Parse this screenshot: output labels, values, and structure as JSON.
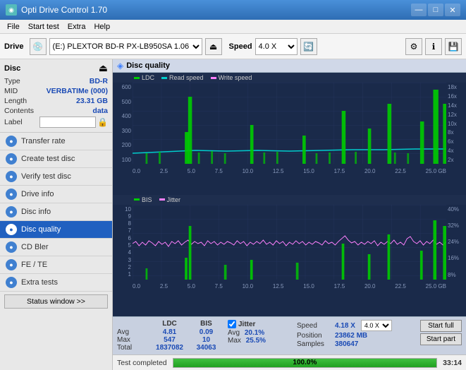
{
  "titlebar": {
    "icon": "◉",
    "title": "Opti Drive Control 1.70",
    "controls": {
      "minimize": "—",
      "maximize": "□",
      "close": "✕"
    }
  },
  "menubar": {
    "items": [
      "File",
      "Start test",
      "Extra",
      "Help"
    ]
  },
  "toolbar": {
    "drive_label": "Drive",
    "drive_value": "(E:) PLEXTOR BD-R  PX-LB950SA 1.06",
    "speed_label": "Speed",
    "speed_value": "4.0 X"
  },
  "disc": {
    "title": "Disc",
    "type_label": "Type",
    "type_value": "BD-R",
    "mid_label": "MID",
    "mid_value": "VERBATIMe (000)",
    "length_label": "Length",
    "length_value": "23.31 GB",
    "contents_label": "Contents",
    "contents_value": "data",
    "label_label": "Label"
  },
  "nav": {
    "items": [
      {
        "id": "transfer-rate",
        "label": "Transfer rate",
        "active": false
      },
      {
        "id": "create-test-disc",
        "label": "Create test disc",
        "active": false
      },
      {
        "id": "verify-test-disc",
        "label": "Verify test disc",
        "active": false
      },
      {
        "id": "drive-info",
        "label": "Drive info",
        "active": false
      },
      {
        "id": "disc-info",
        "label": "Disc info",
        "active": false
      },
      {
        "id": "disc-quality",
        "label": "Disc quality",
        "active": true
      },
      {
        "id": "cd-bler",
        "label": "CD Bler",
        "active": false
      },
      {
        "id": "fe-te",
        "label": "FE / TE",
        "active": false
      },
      {
        "id": "extra-tests",
        "label": "Extra tests",
        "active": false
      }
    ],
    "status_btn": "Status window >>"
  },
  "chart": {
    "title": "Disc quality",
    "legend_top": [
      {
        "id": "ldc",
        "label": "LDC",
        "color": "#00cc00"
      },
      {
        "id": "read-speed",
        "label": "Read speed",
        "color": "#00cccc"
      },
      {
        "id": "write-speed",
        "label": "Write speed",
        "color": "#ff80ff"
      }
    ],
    "legend_bottom": [
      {
        "id": "bis",
        "label": "BIS",
        "color": "#00cc00"
      },
      {
        "id": "jitter",
        "label": "Jitter",
        "color": "#ff80ff"
      }
    ],
    "x_labels": [
      "0.0",
      "2.5",
      "5.0",
      "7.5",
      "10.0",
      "12.5",
      "15.0",
      "17.5",
      "20.0",
      "22.5",
      "25.0 GB"
    ],
    "y_left_top": [
      "600",
      "500",
      "400",
      "300",
      "200",
      "100"
    ],
    "y_right_top": [
      "18x",
      "16x",
      "14x",
      "12x",
      "10x",
      "8x",
      "6x",
      "4x",
      "2x"
    ],
    "y_left_bottom": [
      "10",
      "9",
      "8",
      "7",
      "6",
      "5",
      "4",
      "3",
      "2",
      "1"
    ],
    "y_right_bottom": [
      "40%",
      "32%",
      "24%",
      "16%",
      "8%"
    ]
  },
  "stats": {
    "cols": [
      "",
      "LDC",
      "BIS"
    ],
    "rows": [
      {
        "label": "Avg",
        "ldc": "4.81",
        "bis": "0.09"
      },
      {
        "label": "Max",
        "ldc": "547",
        "bis": "10"
      },
      {
        "label": "Total",
        "ldc": "1837082",
        "bis": "34063"
      }
    ],
    "jitter_label": "Jitter",
    "jitter_avg": "20.1%",
    "jitter_max": "25.5%",
    "speed_label": "Speed",
    "speed_value": "4.18 X",
    "speed_select": "4.0 X",
    "position_label": "Position",
    "position_value": "23862 MB",
    "samples_label": "Samples",
    "samples_value": "380647",
    "start_full": "Start full",
    "start_part": "Start part"
  },
  "bottom": {
    "status_text": "Test completed",
    "progress_pct": 100,
    "progress_label": "100.0%",
    "time": "33:14"
  }
}
